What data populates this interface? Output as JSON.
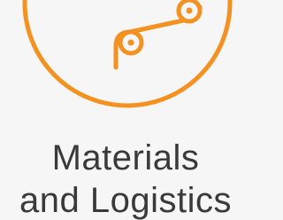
{
  "category": {
    "icon": "conveyor-rollers-icon",
    "accent_color": "#f39220",
    "title_line1": "Materials",
    "title_line2": "and Logistics"
  }
}
